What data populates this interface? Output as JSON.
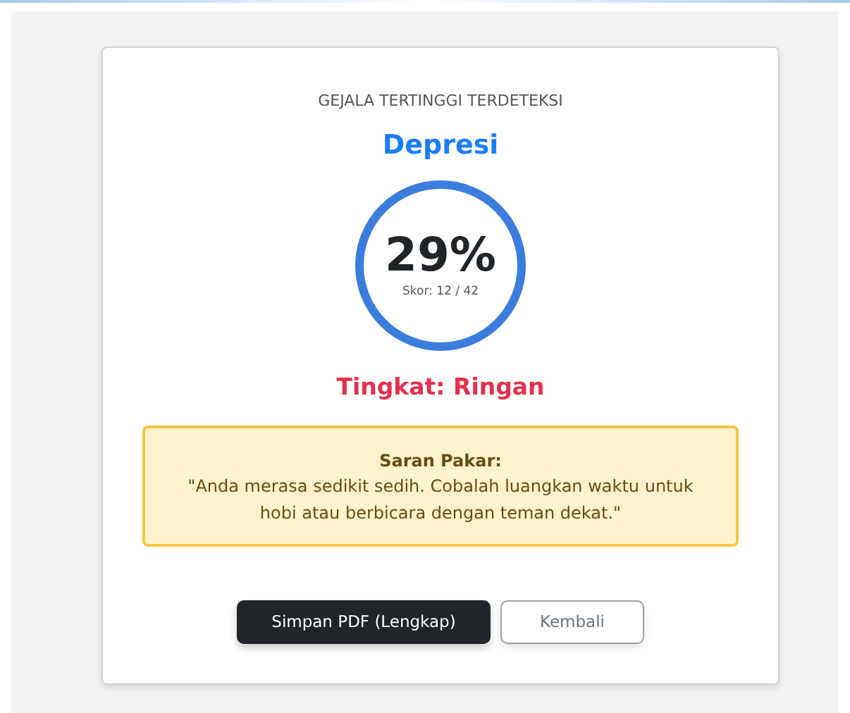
{
  "result": {
    "heading": "GEJALA TERTINGGI TERDETEKSI",
    "symptom": "Depresi",
    "percent": "29%",
    "score": "Skor: 12 / 42",
    "level_text": "Tingkat: Ringan"
  },
  "advice": {
    "title": "Saran Pakar:",
    "text": "\"Anda merasa sedikit sedih. Cobalah luangkan waktu untuk hobi atau berbicara dengan teman dekat.\""
  },
  "buttons": [
    {
      "label": "Simpan PDF (Lengkap)",
      "kind": "primary"
    },
    {
      "label": "Kembali",
      "kind": "secondary"
    }
  ]
}
